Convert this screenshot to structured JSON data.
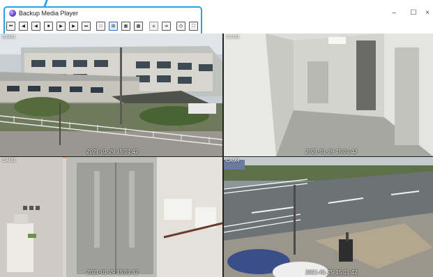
{
  "window": {
    "title": "Backup Media Player",
    "minimize_glyph": "–",
    "maximize_glyph": "☐",
    "close_glyph": "×"
  },
  "toolbar": {
    "buttons": [
      {
        "name": "skip-to-start-button",
        "glyph": "⏮",
        "icon": "skip-start-icon"
      },
      {
        "name": "step-back-button",
        "glyph": "◀",
        "icon": "step-back-icon"
      },
      {
        "name": "reverse-play-button",
        "glyph": "◀",
        "icon": "reverse-play-icon"
      },
      {
        "name": "stop-button",
        "glyph": "■",
        "icon": "stop-icon"
      },
      {
        "name": "frame-forward-button",
        "glyph": "▶",
        "icon": "frame-forward-icon"
      },
      {
        "name": "play-button",
        "glyph": "▶",
        "icon": "play-icon"
      },
      {
        "name": "skip-to-end-button",
        "glyph": "⏭",
        "icon": "skip-end-icon"
      },
      {
        "name": "layout-1x1-button",
        "glyph": "□",
        "icon": "single-view-icon"
      },
      {
        "name": "layout-2x2-button",
        "glyph": "⊞",
        "icon": "quad-view-icon"
      },
      {
        "name": "layout-3x3-button",
        "glyph": "▦",
        "icon": "nine-view-icon"
      },
      {
        "name": "layout-4x4-button",
        "glyph": "▩",
        "icon": "sixteen-view-icon"
      },
      {
        "name": "audio-button",
        "glyph": "◆",
        "icon": "audio-icon"
      },
      {
        "name": "speed-button",
        "glyph": "➔",
        "icon": "speed-icon"
      },
      {
        "name": "time-search-button",
        "glyph": "◷",
        "icon": "clock-icon"
      },
      {
        "name": "fullscreen-button",
        "glyph": "⛶",
        "icon": "fullscreen-icon"
      }
    ]
  },
  "cameras": [
    {
      "label": "CAM1",
      "timestamp": "2021-01-29 15:01:42"
    },
    {
      "label": "CAM2",
      "timestamp": "2021-01-29 15:01:42"
    },
    {
      "label": "CAM3",
      "timestamp": "2021-01-29 15:01:42"
    },
    {
      "label": "CAM4",
      "timestamp": "2021-01-29 15:01:42"
    }
  ],
  "colors": {
    "callout": "#2da0e3",
    "active_tile_border": "#f0a040"
  }
}
